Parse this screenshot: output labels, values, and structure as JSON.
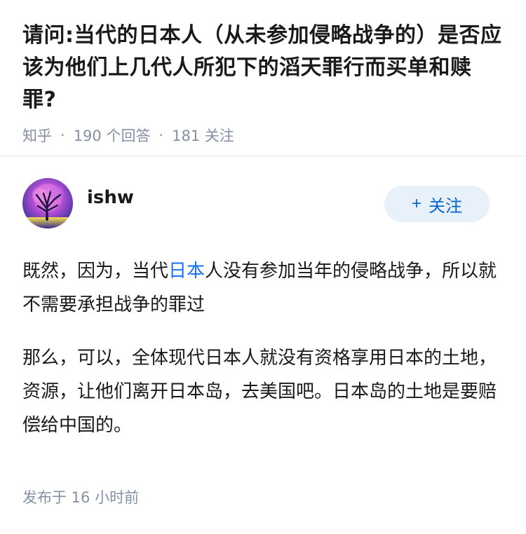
{
  "question": {
    "title": "请问:当代的日本人（从未参加侵略战争的）是否应该为他们上几代人所犯下的滔天罪行而买单和赎罪?",
    "source": "知乎",
    "answer_count": "190 个回答",
    "follower_count": "181 关注"
  },
  "answer": {
    "author_name": "ishw",
    "follow_label": "关注",
    "follow_icon": "plus-icon",
    "paragraph1_before": "既然，因为，当代",
    "paragraph1_keyword": "日本",
    "paragraph1_after": "人没有参加当年的侵略战争，所以就不需要承担战争的罪过",
    "paragraph2": "那么，可以，全体现代日本人就没有资格享用日本的土地，资源，让他们离开日本岛，去美国吧。日本岛的土地是要赔偿给中国的。",
    "publish_time": "发布于 16 小时前"
  },
  "colors": {
    "link_blue": "#1772f6",
    "meta_gray": "#8590a6",
    "follow_bg": "#e8f0f9",
    "follow_text": "#0066cc"
  }
}
